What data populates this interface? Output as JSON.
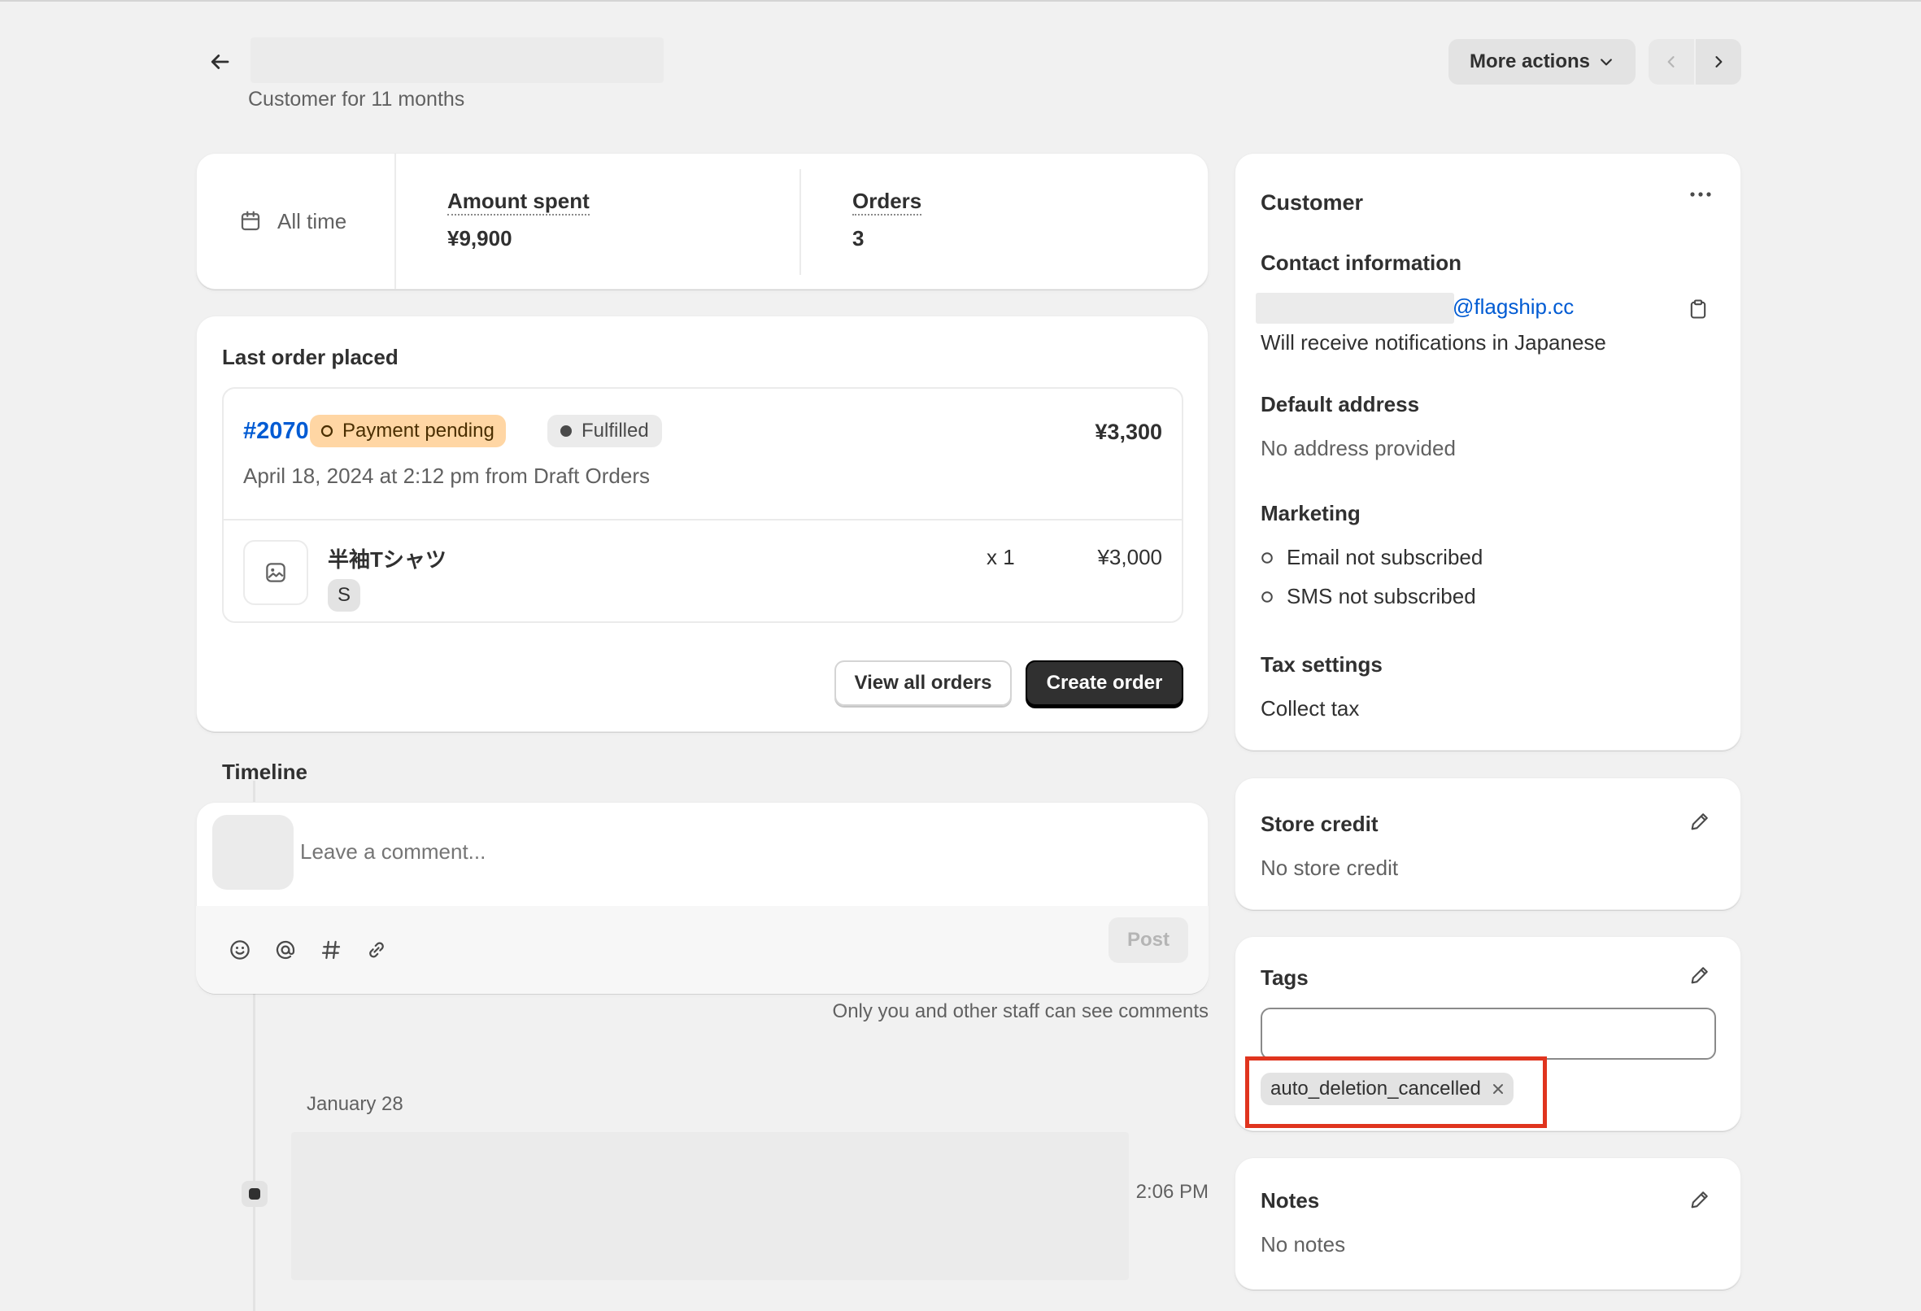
{
  "header": {
    "subtitle": "Customer for 11 months",
    "more_actions_label": "More actions"
  },
  "stats": {
    "range_label": "All time",
    "amount_label": "Amount spent",
    "amount_value": "¥9,900",
    "orders_label": "Orders",
    "orders_value": "3"
  },
  "last_order": {
    "title": "Last order placed",
    "order_number": "#2070",
    "payment_badge": "Payment pending",
    "fulfillment_badge": "Fulfilled",
    "total": "¥3,300",
    "date_line": "April 18, 2024 at 2:12 pm from Draft Orders",
    "item_name": "半袖Tシャツ",
    "item_variant": "S",
    "item_qty": "x 1",
    "item_price": "¥3,000",
    "view_all_label": "View all orders",
    "create_order_label": "Create order"
  },
  "timeline": {
    "title": "Timeline",
    "comment_placeholder": "Leave a comment...",
    "post_label": "Post",
    "staff_note": "Only you and other staff can see comments",
    "date_group": "January 28",
    "event_time": "2:06 PM"
  },
  "customer": {
    "title": "Customer",
    "contact_heading": "Contact information",
    "email_domain": "@flagship.cc",
    "notification_language": "Will receive notifications in Japanese",
    "address_heading": "Default address",
    "address_value": "No address provided",
    "marketing_heading": "Marketing",
    "email_marketing": "Email not subscribed",
    "sms_marketing": "SMS not subscribed",
    "tax_heading": "Tax settings",
    "tax_value": "Collect tax"
  },
  "store_credit": {
    "title": "Store credit",
    "value": "No store credit"
  },
  "tags": {
    "title": "Tags",
    "input_value": "",
    "items": [
      "auto_deletion_cancelled"
    ]
  },
  "notes": {
    "title": "Notes",
    "value": "No notes"
  },
  "colors": {
    "link": "#005bd3",
    "payment_badge_bg": "#ffd6a4",
    "fulfilled_badge_bg": "#ebebeb",
    "primary_button": "#303030",
    "highlight_box": "#e0341e"
  }
}
